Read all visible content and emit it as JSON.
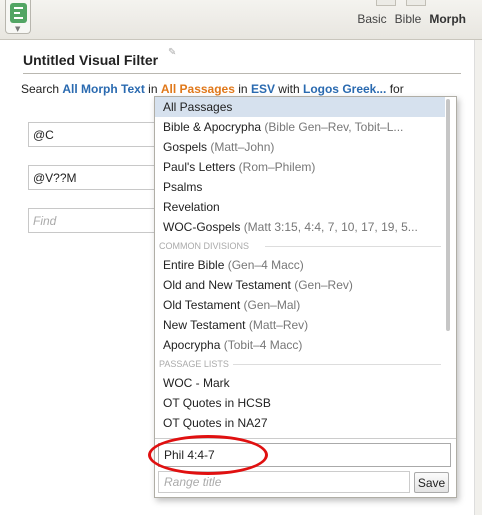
{
  "header": {
    "panel_menu_icon": "panel-menu-icon",
    "tabs": [
      {
        "label": "Basic",
        "active": false
      },
      {
        "label": "Bible",
        "active": false
      },
      {
        "label": "Morph",
        "active": true
      }
    ]
  },
  "filter": {
    "title": "Untitled Visual Filter",
    "edit_icon": "pencil-icon"
  },
  "search_line": {
    "prefix": "Search",
    "text_type": "All Morph Text",
    "in1": "in",
    "passage": "All Passages",
    "in2": "in",
    "version": "ESV",
    "with_word": "with",
    "morph": "Logos Greek...",
    "for_word": "for"
  },
  "query_rows": [
    {
      "value": "@C"
    },
    {
      "value": "@V??M"
    }
  ],
  "find_placeholder": "Find",
  "dropdown": {
    "top_items": [
      {
        "name": "All Passages",
        "detail": "",
        "selected": true
      },
      {
        "name": "Bible & Apocrypha",
        "detail": "(Bible Gen–Rev, Tobit–L...",
        "selected": false
      },
      {
        "name": "Gospels",
        "detail": "(Matt–John)",
        "selected": false
      },
      {
        "name": "Paul's Letters",
        "detail": "(Rom–Philem)",
        "selected": false
      },
      {
        "name": "Psalms",
        "detail": "",
        "selected": false
      },
      {
        "name": "Revelation",
        "detail": "",
        "selected": false
      },
      {
        "name": "WOC-Gospels",
        "detail": "(Matt 3:15, 4:4, 7, 10, 17, 19, 5...",
        "selected": false
      }
    ],
    "common_header": "COMMON DIVISIONS",
    "common_items": [
      {
        "name": "Entire Bible",
        "detail": "(Gen–4 Macc)"
      },
      {
        "name": "Old and New Testament",
        "detail": "(Gen–Rev)"
      },
      {
        "name": "Old Testament",
        "detail": "(Gen–Mal)"
      },
      {
        "name": "New Testament",
        "detail": "(Matt–Rev)"
      },
      {
        "name": "Apocrypha",
        "detail": "(Tobit–4 Macc)"
      }
    ],
    "lists_header": "PASSAGE LISTS",
    "list_items": [
      {
        "name": "WOC - Mark"
      },
      {
        "name": "OT Quotes in HCSB"
      },
      {
        "name": "OT Quotes in NA27"
      }
    ],
    "range_value": "Phil 4:4-7",
    "range_title_placeholder": "Range title",
    "save_label": "Save"
  },
  "colors": {
    "link_blue": "#2a6ab0",
    "link_orange": "#e0781a",
    "selection": "#d6e1ee",
    "annotation_red": "#e01010"
  }
}
